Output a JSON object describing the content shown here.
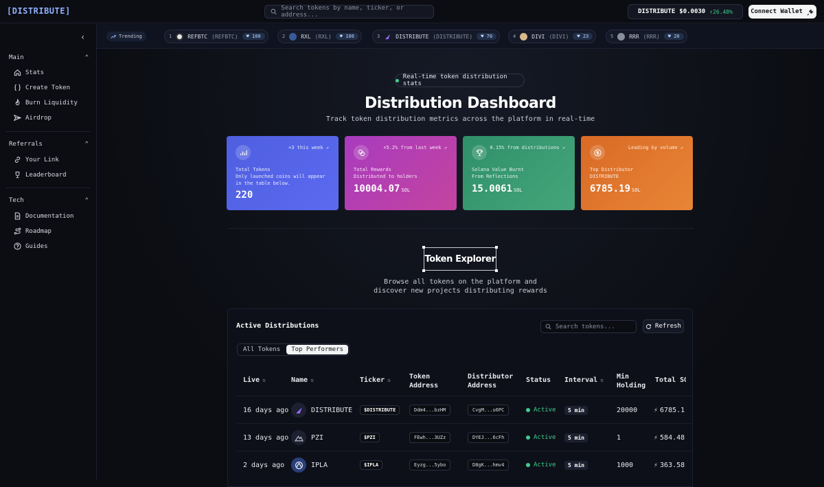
{
  "header": {
    "logo": "[DISTRIBUTE]",
    "search_placeholder": "Search tokens by name, ticker, or address...",
    "price_symbol": "DISTRIBUTE",
    "price_value": "$0.0030",
    "price_change": "↑26.48%",
    "connect_label": "Connect Wallet"
  },
  "sidebar": {
    "sections": [
      {
        "label": "Main",
        "items": [
          {
            "label": "Stats",
            "icon": "home-icon"
          },
          {
            "label": "Create Token",
            "icon": "braces-icon"
          },
          {
            "label": "Burn Liquidity",
            "icon": "flame-icon"
          },
          {
            "label": "Airdrop",
            "icon": "send-icon"
          }
        ]
      },
      {
        "label": "Referrals",
        "items": [
          {
            "label": "Your Link",
            "icon": "link-icon"
          },
          {
            "label": "Leaderboard",
            "icon": "trophy-icon"
          }
        ]
      },
      {
        "label": "Tech",
        "items": [
          {
            "label": "Documentation",
            "icon": "file-icon"
          },
          {
            "label": "Roadmap",
            "icon": "route-icon"
          },
          {
            "label": "Guides",
            "icon": "help-icon"
          }
        ]
      }
    ]
  },
  "trending": {
    "label": "Trending",
    "items": [
      {
        "rank": "1",
        "name": "REFBTC",
        "ticker": "(REFBTC)",
        "score": "100"
      },
      {
        "rank": "2",
        "name": "RXL",
        "ticker": "(RXL)",
        "score": "100"
      },
      {
        "rank": "3",
        "name": "DISTRIBUTE",
        "ticker": "(DISTRIBUTE)",
        "score": "70"
      },
      {
        "rank": "4",
        "name": "DIVI",
        "ticker": "(DIVI)",
        "score": "23"
      },
      {
        "rank": "5",
        "name": "RRR",
        "ticker": "(RRR)",
        "score": "20"
      }
    ]
  },
  "hero": {
    "pill": "Real-time token distribution stats",
    "title": "Distribution Dashboard",
    "subtitle": "Track token distribution metrics across the platform in real-time"
  },
  "cards": [
    {
      "delta": "+3 this week ↗",
      "label": "Total Tokens\nOnly launched coins will appear\nin the table below.",
      "value": "220",
      "unit": "",
      "color": "#4f5fe0"
    },
    {
      "delta": "+5.2% from last week ↗",
      "label": "Total Rewards\nDistributed to holders",
      "value": "10004.07",
      "unit": "SOL",
      "color": "#b23fb8"
    },
    {
      "delta": "0.15% from distributions ↗",
      "label": "Solana Value Burnt\nFrom Reflections",
      "value": "15.0061",
      "unit": "SOL",
      "color": "#3c9a6e"
    },
    {
      "delta": "Leading by volume ↗",
      "label": "Top Distributor\nDISTRIBUTE",
      "value": "6785.19",
      "unit": "SOL",
      "color": "#e0782b"
    }
  ],
  "explorer": {
    "title": "Token Explorer",
    "desc_line1": "Browse all tokens on the platform and",
    "desc_line2": "discover new projects distributing rewards"
  },
  "table": {
    "title": "Active Distributions",
    "search_placeholder": "Search tokens...",
    "refresh_label": "Refresh",
    "tabs": [
      "All Tokens",
      "Top Performers"
    ],
    "active_tab": "Top Performers",
    "headers": {
      "live": "Live",
      "name": "Name",
      "ticker": "Ticker",
      "token_address_1": "Token",
      "token_address_2": "Address",
      "distributor_address_1": "Distributor",
      "distributor_address_2": "Address",
      "status": "Status",
      "interval": "Interval",
      "min_holding_1": "Min",
      "min_holding_2": "Holding",
      "total": "Total SO"
    },
    "rows": [
      {
        "live": "16 days ago",
        "name": "DISTRIBUTE",
        "ticker": "$DISTRIBUTE",
        "token_address": "Ddm4...bzHM",
        "distributor_address": "CvgM...u6PC",
        "status": "Active",
        "interval": "5 min",
        "min_holding": "20000",
        "total": "6785.1"
      },
      {
        "live": "13 days ago",
        "name": "PZI",
        "ticker": "$PZI",
        "token_address": "FEwh...3UZz",
        "distributor_address": "DYEJ...6cFh",
        "status": "Active",
        "interval": "5 min",
        "min_holding": "1",
        "total": "584.48"
      },
      {
        "live": "2 days ago",
        "name": "IPLA",
        "ticker": "$IPLA",
        "token_address": "Eyzg...5ybo",
        "distributor_address": "D8gK...hmv4",
        "status": "Active",
        "interval": "5 min",
        "min_holding": "1000",
        "total": "363.58"
      }
    ]
  }
}
